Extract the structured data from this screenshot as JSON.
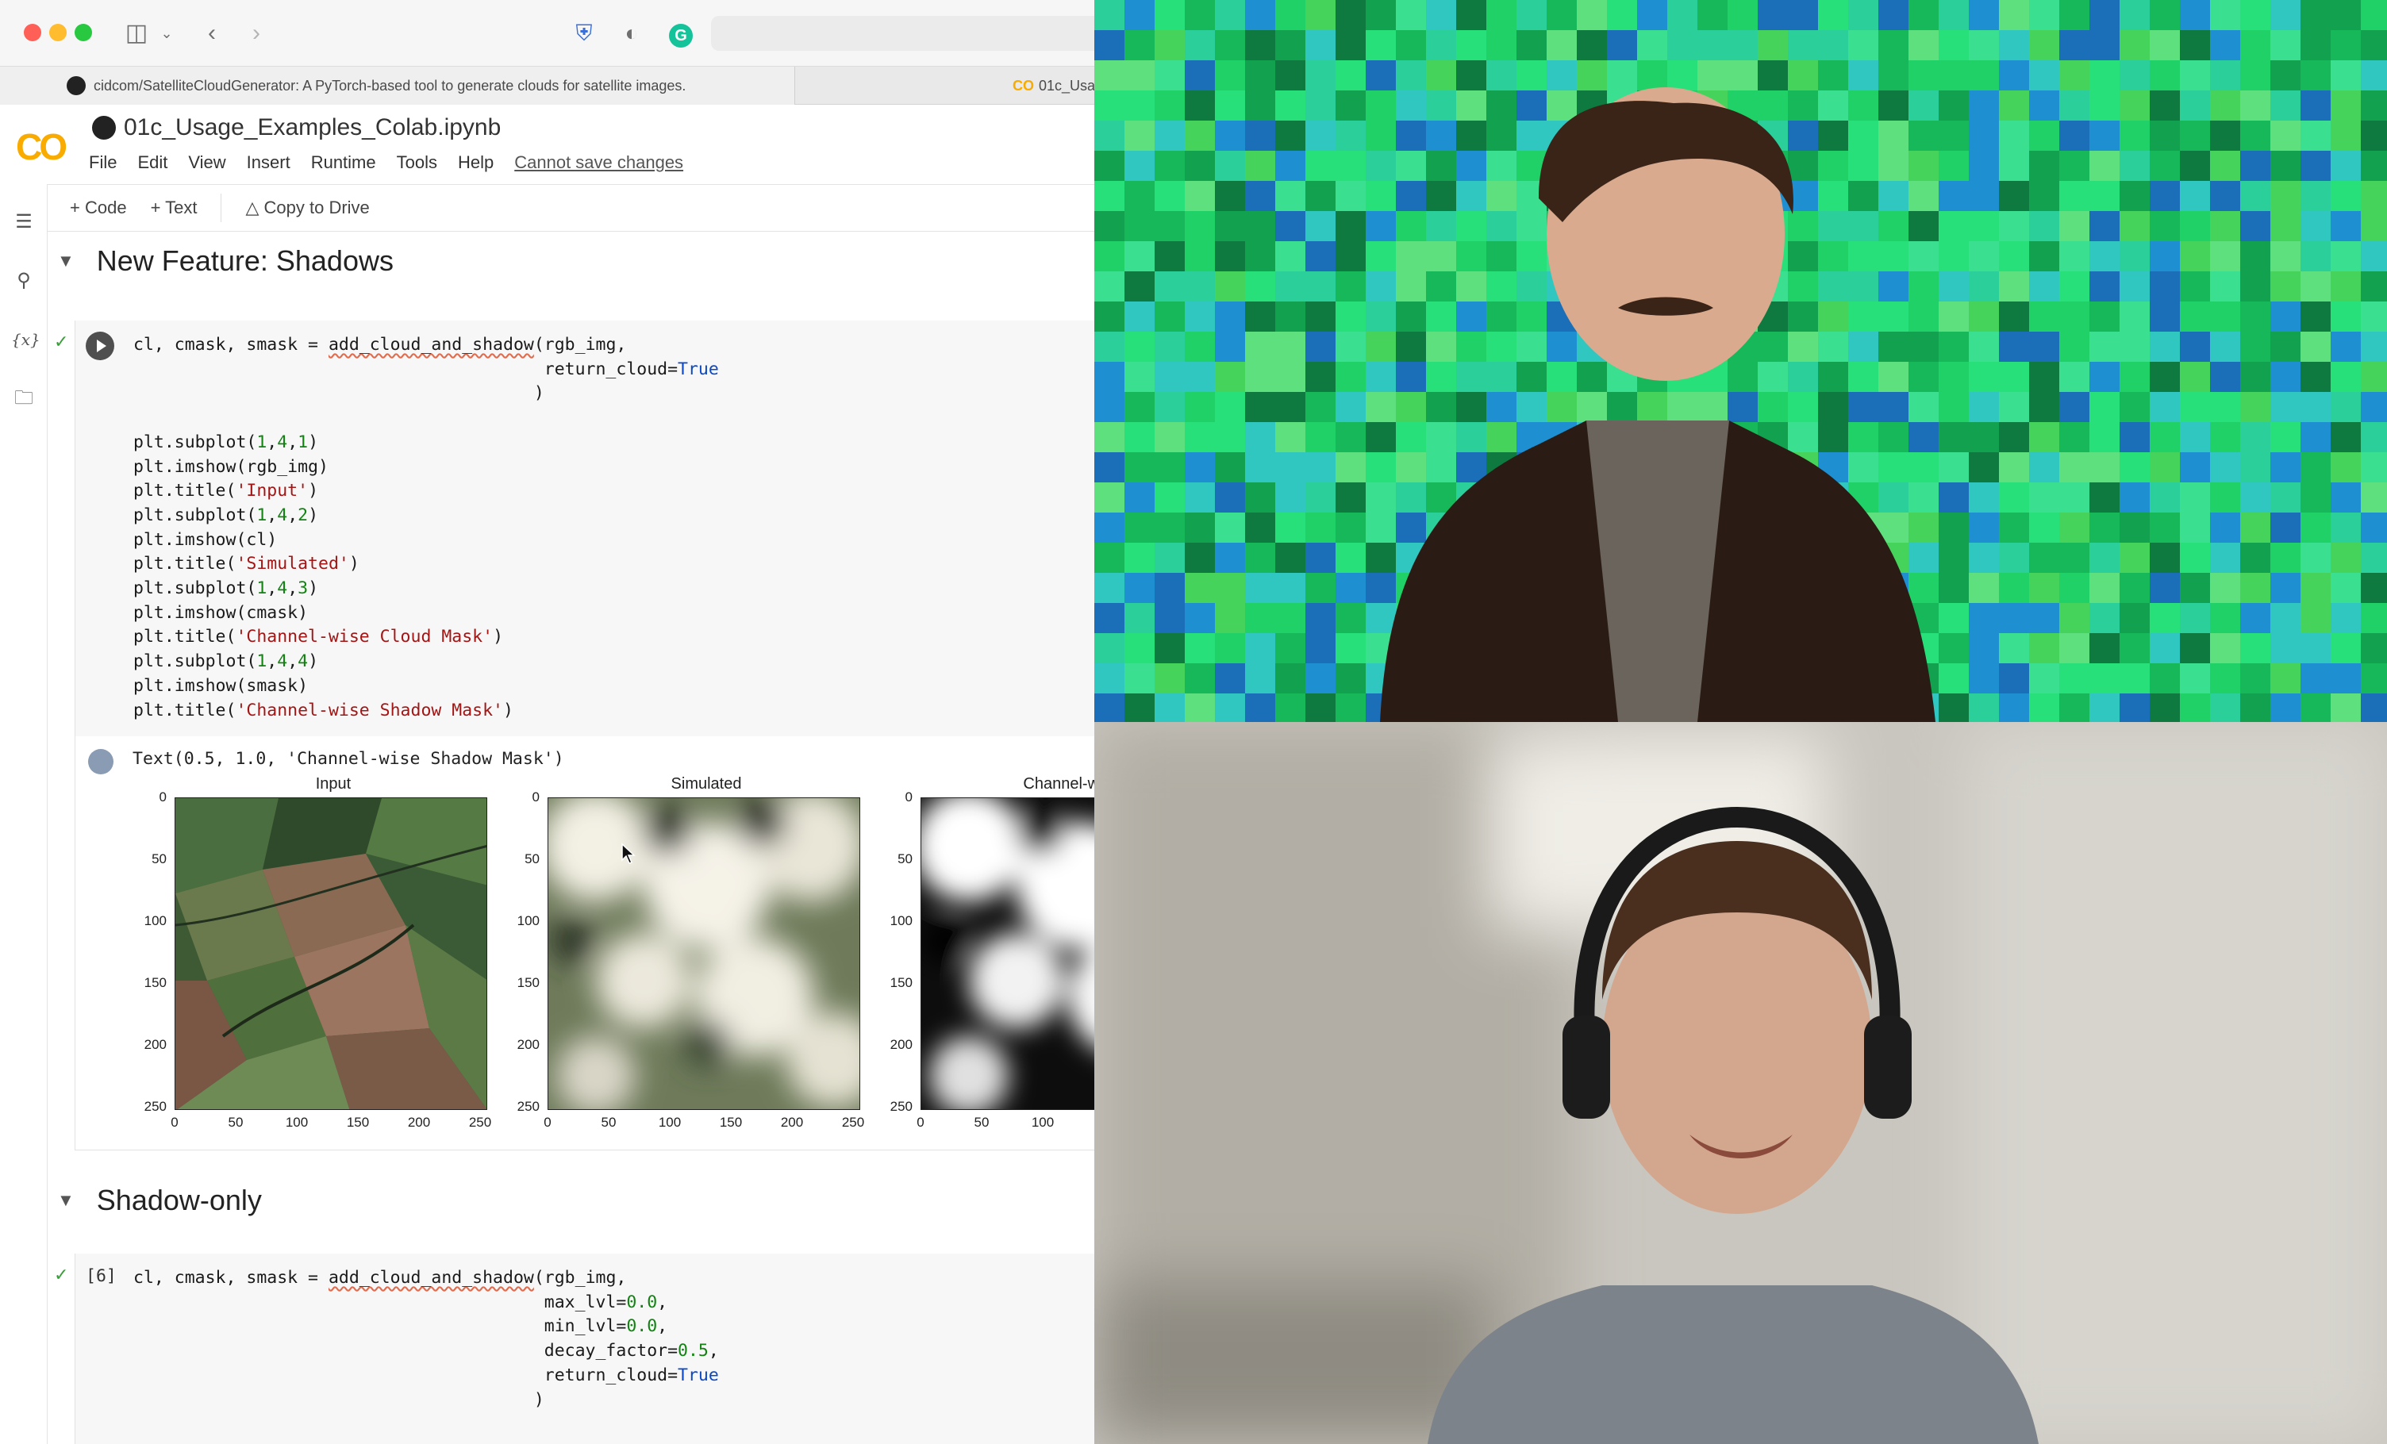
{
  "browser": {
    "tab_active": "cidcom/SatelliteCloudGenerator: A PyTorch-based tool to generate clouds for satellite images.",
    "tab_second": "01c_Usa"
  },
  "colab": {
    "logo": "CO",
    "notebook_title": "01c_Usage_Examples_Colab.ipynb",
    "menu": [
      "File",
      "Edit",
      "View",
      "Insert",
      "Runtime",
      "Tools",
      "Help"
    ],
    "cannot_save": "Cannot save changes",
    "cell_toolbar": {
      "code": "+ Code",
      "text": "+ Text",
      "copy_to_drive": "Copy to Drive"
    }
  },
  "sections": [
    {
      "title": "New Feature: Shadows"
    },
    {
      "title": "Shadow-only"
    }
  ],
  "cell1": {
    "lines": [
      "cl, cmask, smask = add_cloud_and_shadow(rgb_img,",
      "                                        return_cloud=True",
      "                                       )",
      "",
      "plt.subplot(1,4,1)",
      "plt.imshow(rgb_img)",
      "plt.title('Input')",
      "plt.subplot(1,4,2)",
      "plt.imshow(cl)",
      "plt.title('Simulated')",
      "plt.subplot(1,4,3)",
      "plt.imshow(cmask)",
      "plt.title('Channel-wise Cloud Mask')",
      "plt.subplot(1,4,4)",
      "plt.imshow(smask)",
      "plt.title('Channel-wise Shadow Mask')"
    ],
    "output_text": "Text(0.5, 1.0, 'Channel-wise Shadow Mask')"
  },
  "plots": [
    {
      "title": "Input"
    },
    {
      "title": "Simulated"
    },
    {
      "title": "Channel-wise C"
    }
  ],
  "plot_ticks": {
    "y": [
      "0",
      "50",
      "100",
      "150",
      "200",
      "250"
    ],
    "x": [
      "0",
      "50",
      "100",
      "150",
      "200",
      "250"
    ]
  },
  "cell2": {
    "exec_count": "[6]",
    "lines": [
      "cl, cmask, smask = add_cloud_and_shadow(rgb_img,",
      "                                        max_lvl=0.0,",
      "                                        min_lvl=0.0,",
      "                                        decay_factor=0.5,",
      "                                        return_cloud=True",
      "                                       )"
    ]
  },
  "colors": {
    "colab_orange": "#f9ab00",
    "green_screen": "#1fd166",
    "keyword_blue": "#0b48c6",
    "number_green": "#128312",
    "string_red": "#a31515"
  }
}
